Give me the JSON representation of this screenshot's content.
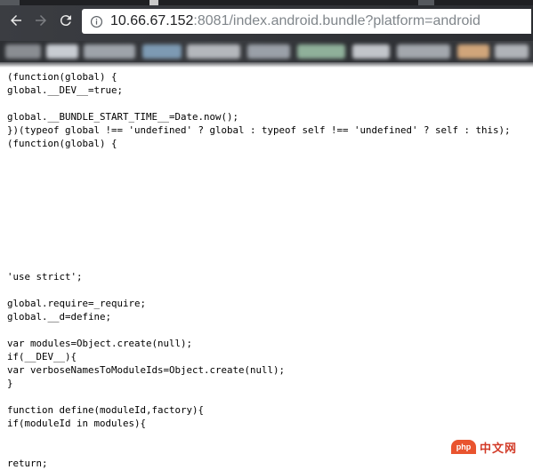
{
  "browser": {
    "url_host": "10.66.67.152",
    "url_rest": ":8081/index.android.bundle?platform=android",
    "back_icon": "arrow-left-icon",
    "forward_icon": "arrow-right-icon",
    "reload_icon": "reload-icon",
    "info_icon": "info-icon"
  },
  "code_lines": [
    "(function(global) {",
    "global.__DEV__=true;",
    "",
    "global.__BUNDLE_START_TIME__=Date.now();",
    "})(typeof global !== 'undefined' ? global : typeof self !== 'undefined' ? self : this);",
    "(function(global) {",
    "",
    "",
    "",
    "",
    "",
    "",
    "",
    "",
    "",
    "'use strict';",
    "",
    "global.require=_require;",
    "global.__d=define;",
    "",
    "var modules=Object.create(null);",
    "if(__DEV__){",
    "var verboseNamesToModuleIds=Object.create(null);",
    "}",
    "",
    "function define(moduleId,factory){",
    "if(moduleId in modules){",
    "",
    "",
    "return;"
  ],
  "watermark": {
    "logo_text": "php",
    "text": "中文网"
  }
}
